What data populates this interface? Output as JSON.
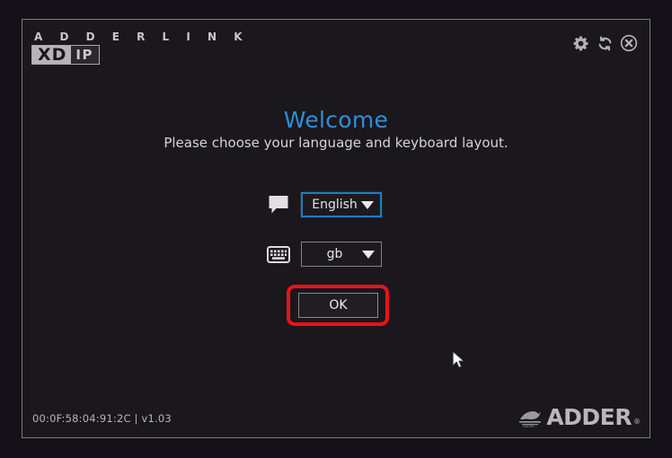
{
  "device": {
    "brand_line": "A D D E R L I N K",
    "model_prefix": "XD",
    "model_suffix": "IP"
  },
  "header": {
    "icons": [
      {
        "name": "gear-icon",
        "label": "Settings"
      },
      {
        "name": "refresh-icon",
        "label": "Refresh"
      },
      {
        "name": "close-icon",
        "label": "Close"
      }
    ]
  },
  "main": {
    "title": "Welcome",
    "subtitle": "Please choose your language and keyboard layout.",
    "title_color": "#2f8fd6"
  },
  "form": {
    "language": {
      "icon": "speech-bubble-icon",
      "value": "English",
      "focused": true,
      "focus_color": "#1a7fc4"
    },
    "keyboard": {
      "icon": "keyboard-icon",
      "value": "gb",
      "focused": false
    },
    "submit": {
      "label": "OK",
      "highlight_color": "#e8131a"
    }
  },
  "footer": {
    "mac_and_version": "00:0F:58:04:91:2C | v1.03",
    "logo_text": "ADDER",
    "logo_tm": "®"
  }
}
